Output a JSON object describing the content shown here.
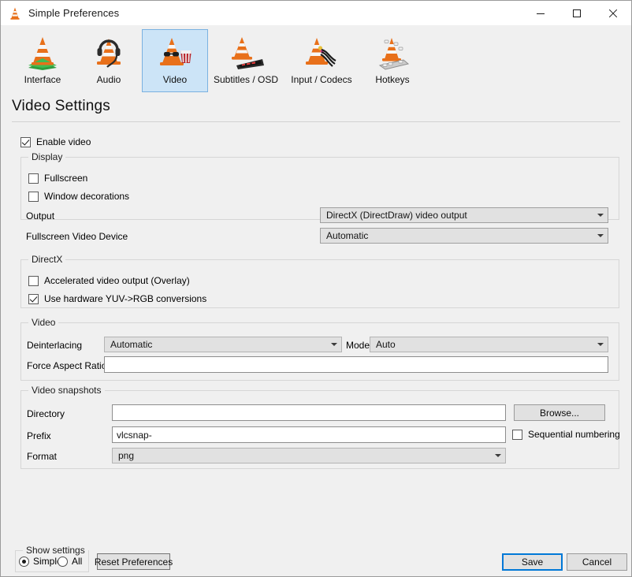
{
  "window": {
    "title": "Simple Preferences",
    "icon": "vlc-cone-icon",
    "minimize_label": "–",
    "maximize_label": "□",
    "close_label": "✕"
  },
  "toolbar": {
    "categories": [
      {
        "label": "Interface",
        "icon": "vlc-cone-interface-icon",
        "selected": false
      },
      {
        "label": "Audio",
        "icon": "vlc-cone-audio-icon",
        "selected": false
      },
      {
        "label": "Video",
        "icon": "vlc-cone-video-icon",
        "selected": true
      },
      {
        "label": "Subtitles / OSD",
        "icon": "vlc-cone-subtitles-icon",
        "selected": false
      },
      {
        "label": "Input / Codecs",
        "icon": "vlc-cone-input-icon",
        "selected": false
      },
      {
        "label": "Hotkeys",
        "icon": "vlc-cone-hotkeys-icon",
        "selected": false
      }
    ]
  },
  "page": {
    "title": "Video Settings"
  },
  "enable_video": {
    "label": "Enable video",
    "checked": true
  },
  "display_group": {
    "title": "Display",
    "fullscreen": {
      "label": "Fullscreen",
      "checked": false
    },
    "window_decorations": {
      "label": "Window decorations",
      "checked": false
    },
    "output": {
      "label": "Output",
      "value": "DirectX (DirectDraw) video output"
    },
    "fullscreen_video_device": {
      "label": "Fullscreen Video Device",
      "value": "Automatic"
    }
  },
  "directx_group": {
    "title": "DirectX",
    "accelerated": {
      "label": "Accelerated video output (Overlay)",
      "checked": false
    },
    "yuv_rgb": {
      "label": "Use hardware YUV->RGB conversions",
      "checked": true
    }
  },
  "video_group": {
    "title": "Video",
    "deinterlacing": {
      "label": "Deinterlacing",
      "value": "Automatic"
    },
    "mode": {
      "label": "Mode",
      "value": "Auto"
    },
    "force_aspect_ratio": {
      "label": "Force Aspect Ratio",
      "value": "",
      "placeholder": ""
    }
  },
  "snapshots_group": {
    "title": "Video snapshots",
    "directory": {
      "label": "Directory",
      "value": "",
      "placeholder": ""
    },
    "browse": {
      "label": "Browse..."
    },
    "prefix": {
      "label": "Prefix",
      "value": "vlcsnap-",
      "placeholder": ""
    },
    "sequential": {
      "label": "Sequential numbering",
      "checked": false
    },
    "format": {
      "label": "Format",
      "value": "png"
    }
  },
  "bottom": {
    "show_settings": {
      "title": "Show settings",
      "simple": {
        "label": "Simple",
        "selected": true
      },
      "all": {
        "label": "All",
        "selected": false
      }
    },
    "reset": {
      "label": "Reset Preferences"
    },
    "save": {
      "label": "Save"
    },
    "cancel": {
      "label": "Cancel"
    }
  },
  "colors": {
    "window_bg": "#f0f0f0",
    "titlebar_bg": "#ffffff",
    "selected_tab_bg": "#cce4f7",
    "selected_tab_border": "#7ab1e0",
    "accent": "#0078d7",
    "cone_orange": "#e8701a",
    "cone_light": "#f5f5f5"
  }
}
